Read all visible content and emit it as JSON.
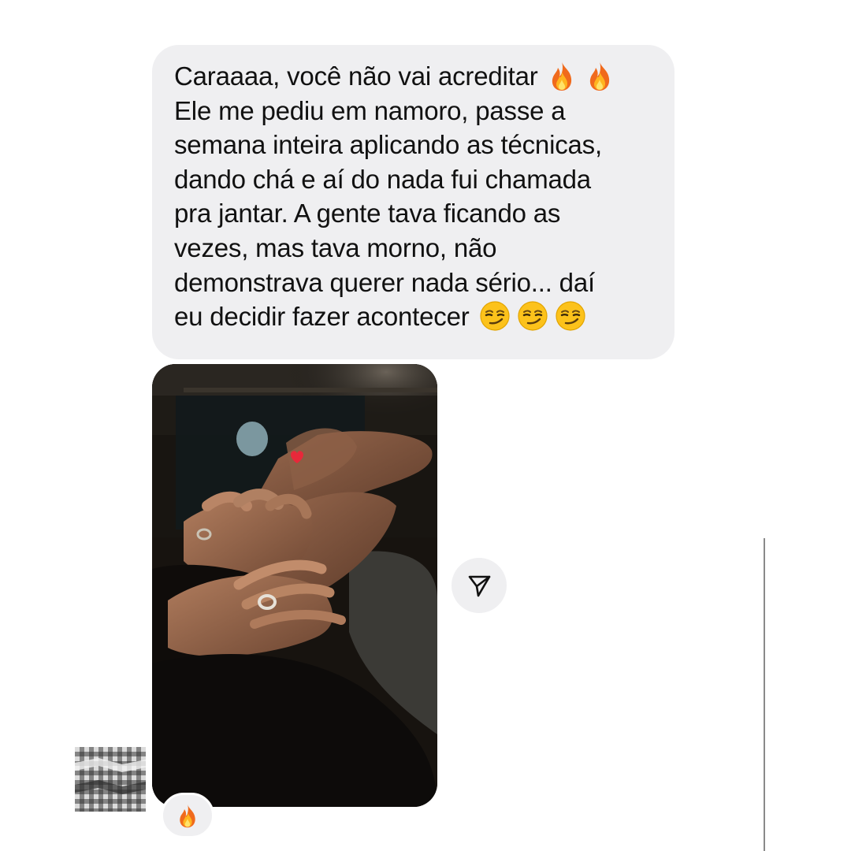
{
  "message": {
    "lines": [
      "Caraaaa, você não vai acreditar",
      "Ele me pediu em namoro, passe a",
      "semana inteira aplicando as técnicas,",
      "dando chá e aí do nada fui chamada",
      "pra jantar. A gente tava ficando as",
      "vezes, mas tava morno, não",
      "demonstrava querer nada sério... daí",
      "eu decidir fazer acontecer"
    ],
    "line1_emojis": [
      "fire-emoji",
      "fire-emoji"
    ],
    "line8_emojis": [
      "smirk-emoji",
      "smirk-emoji",
      "smirk-emoji"
    ]
  },
  "photo": {
    "description_icon": "photo-attachment",
    "sticker": "heart-emoji"
  },
  "share": {
    "icon": "paper-plane-icon"
  },
  "reaction": {
    "emoji": "fire-emoji"
  },
  "avatar": {
    "icon": "pixelated-avatar"
  },
  "colors": {
    "bubble_bg": "#efeff1",
    "text": "#111111",
    "page_bg": "#ffffff"
  }
}
